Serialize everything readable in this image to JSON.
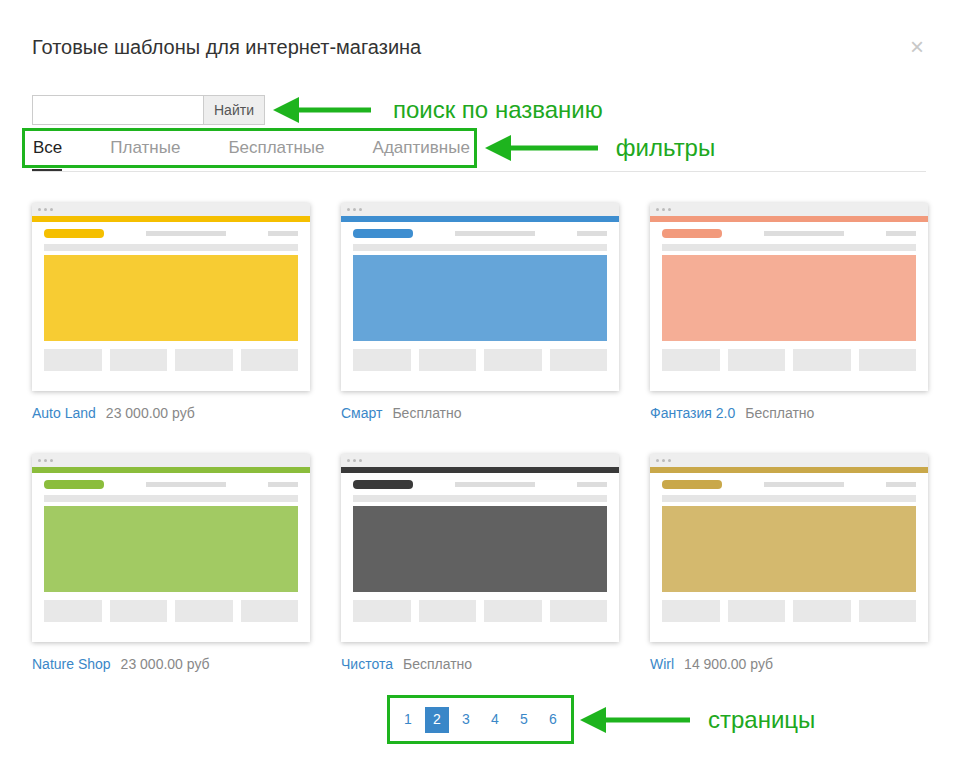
{
  "dialog": {
    "title": "Готовые шаблоны для интернет-магазина",
    "close": "×"
  },
  "search": {
    "button": "Найти"
  },
  "filters": [
    {
      "label": "Все",
      "selected": true
    },
    {
      "label": "Платные",
      "selected": false
    },
    {
      "label": "Бесплатные",
      "selected": false
    },
    {
      "label": "Адаптивные",
      "selected": false
    }
  ],
  "templates": [
    {
      "name": "Auto Land",
      "price": "23 000.00 руб",
      "color": "#f5bf00"
    },
    {
      "name": "Смарт",
      "price": "Бесплатно",
      "color": "#3e8ed0"
    },
    {
      "name": "Фантазия 2.0",
      "price": "Бесплатно",
      "color": "#f29a7c"
    },
    {
      "name": "Nature Shop",
      "price": "23 000.00 руб",
      "color": "#8bbd3c"
    },
    {
      "name": "Чистота",
      "price": "Бесплатно",
      "color": "#3a3a3a"
    },
    {
      "name": "Wirl",
      "price": "14 900.00 руб",
      "color": "#c9a84a"
    }
  ],
  "pagination": [
    {
      "label": "1",
      "selected": false
    },
    {
      "label": "2",
      "selected": true
    },
    {
      "label": "3",
      "selected": false
    },
    {
      "label": "4",
      "selected": false
    },
    {
      "label": "5",
      "selected": false
    },
    {
      "label": "6",
      "selected": false
    }
  ],
  "annotations": {
    "search": "поиск по названию",
    "filters": "фильтры",
    "pages": "страницы"
  }
}
